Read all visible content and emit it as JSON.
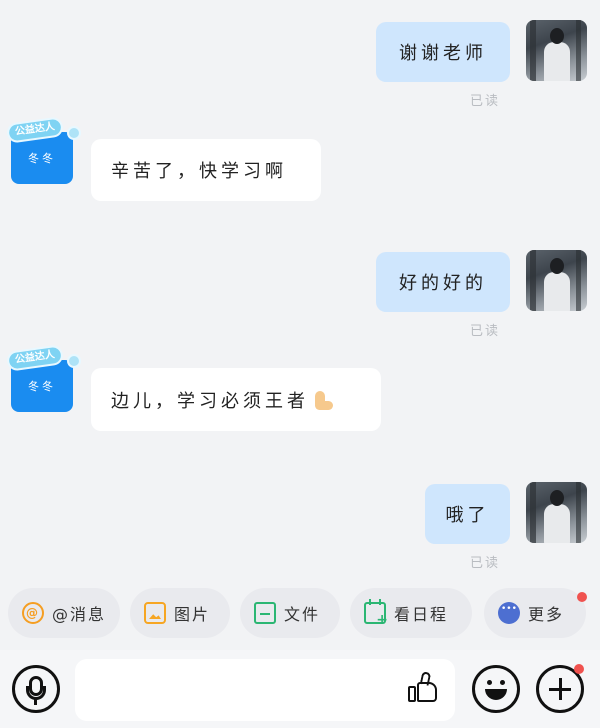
{
  "messages": [
    {
      "from": "self",
      "text": "谢谢老师",
      "read": "已读"
    },
    {
      "from": "other",
      "badge": "公益达人",
      "name": "冬冬",
      "text": "辛苦了，快学习啊"
    },
    {
      "from": "self",
      "text": "好的好的",
      "read": "已读"
    },
    {
      "from": "other",
      "badge": "公益达人",
      "name": "冬冬",
      "text": "边儿，学习必须王者",
      "emoji": "flexed-biceps"
    },
    {
      "from": "self",
      "text": "哦了",
      "read": "已读"
    }
  ],
  "toolbar": {
    "mention_label": "@消息",
    "image_label": "图片",
    "file_label": "文件",
    "schedule_label": "看日程",
    "more_label": "更多"
  },
  "input": {
    "placeholder": ""
  },
  "colors": {
    "self_bubble": "#cfe6fd",
    "other_bubble": "#ffffff",
    "avatar_blue": "#1a8cf0",
    "notification_dot": "#f0524f"
  },
  "icons": [
    "mention-icon",
    "image-icon",
    "file-icon",
    "calendar-add-icon",
    "more-icon",
    "microphone-icon",
    "thumbs-up-icon",
    "emoji-icon",
    "plus-icon"
  ]
}
